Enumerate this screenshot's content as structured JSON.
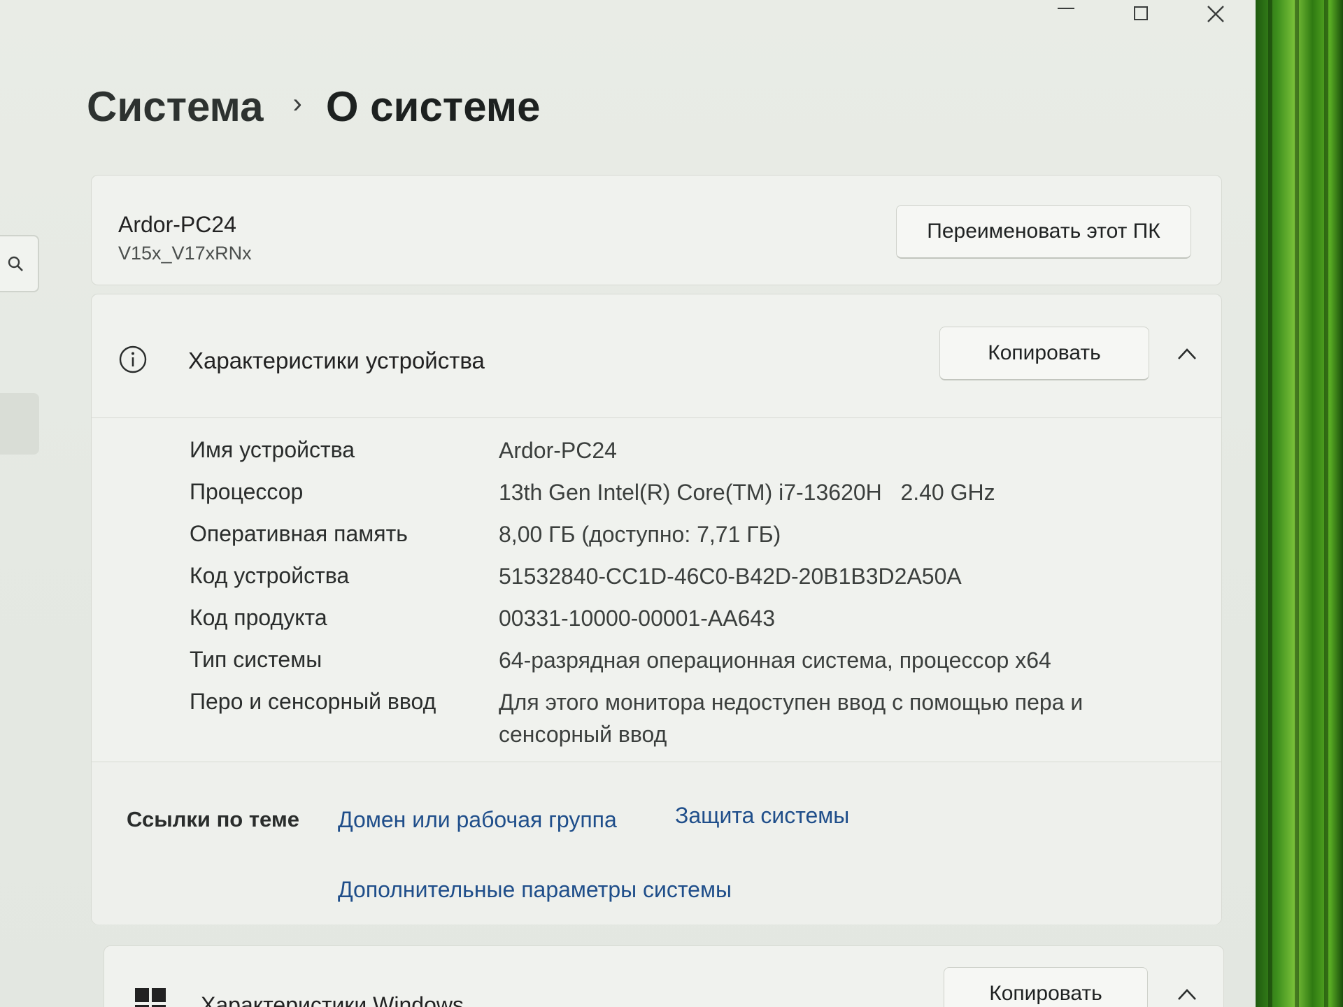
{
  "window": {
    "controls": {
      "minimize": "minimize-icon",
      "maximize": "maximize-icon",
      "close": "close-icon"
    }
  },
  "breadcrumb": {
    "parent": "Система",
    "separator": "›",
    "current": "О системе"
  },
  "pc": {
    "name": "Ardor-PC24",
    "model": "V15x_V17xRNx",
    "rename_label": "Переименовать этот ПК"
  },
  "device_specs": {
    "title": "Характеристики устройства",
    "copy_label": "Копировать",
    "rows": [
      {
        "label": "Имя устройства",
        "value": "Ardor-PC24"
      },
      {
        "label": "Процессор",
        "value": "13th Gen Intel(R) Core(TM) i7-13620H   2.40 GHz"
      },
      {
        "label": "Оперативная память",
        "value": "8,00 ГБ (доступно: 7,71 ГБ)"
      },
      {
        "label": "Код устройства",
        "value": "51532840-CC1D-46C0-B42D-20B1B3D2A50A"
      },
      {
        "label": "Код продукта",
        "value": "00331-10000-00001-AA643"
      },
      {
        "label": "Тип системы",
        "value": "64-разрядная операционная система, процессор x64"
      },
      {
        "label": "Перо и сенсорный ввод",
        "value": "Для этого монитора недоступен ввод с помощью пера и сенсорный ввод"
      }
    ]
  },
  "related": {
    "label": "Ссылки по теме",
    "links": [
      "Домен или рабочая группа",
      "Защита системы",
      "Дополнительные параметры системы"
    ]
  },
  "windows_specs": {
    "title": "Характеристики Windows",
    "copy_label": "Копировать"
  },
  "colors": {
    "link": "#1f4e8a",
    "card": "#f0f2ee",
    "page": "#e6eae4"
  }
}
